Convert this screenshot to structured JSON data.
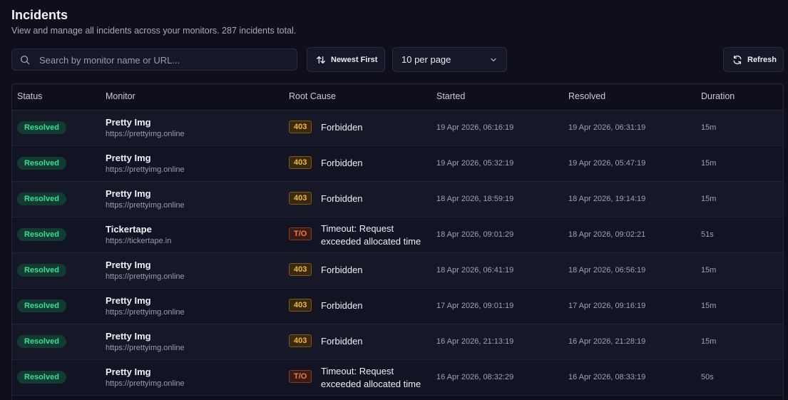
{
  "header": {
    "title": "Incidents",
    "subtitle": "View and manage all incidents across your monitors. 287 incidents total."
  },
  "toolbar": {
    "search_placeholder": "Search by monitor name or URL...",
    "sort_label": "Newest First",
    "per_page_value": "10 per page",
    "refresh_label": "Refresh"
  },
  "table": {
    "columns": [
      "Status",
      "Monitor",
      "Root Cause",
      "Started",
      "Resolved",
      "Duration"
    ],
    "rows": [
      {
        "status": "Resolved",
        "monitor": "Pretty Img",
        "url": "https://prettyimg.online",
        "code": "403",
        "cause": "Forbidden",
        "started": "19 Apr 2026, 06:16:19",
        "resolved": "19 Apr 2026, 06:31:19",
        "duration": "15m"
      },
      {
        "status": "Resolved",
        "monitor": "Pretty Img",
        "url": "https://prettyimg.online",
        "code": "403",
        "cause": "Forbidden",
        "started": "19 Apr 2026, 05:32:19",
        "resolved": "19 Apr 2026, 05:47:19",
        "duration": "15m"
      },
      {
        "status": "Resolved",
        "monitor": "Pretty Img",
        "url": "https://prettyimg.online",
        "code": "403",
        "cause": "Forbidden",
        "started": "18 Apr 2026, 18:59:19",
        "resolved": "18 Apr 2026, 19:14:19",
        "duration": "15m"
      },
      {
        "status": "Resolved",
        "monitor": "Tickertape",
        "url": "https://tickertape.in",
        "code": "T/O",
        "cause": "Timeout: Request exceeded allocated time",
        "started": "18 Apr 2026, 09:01:29",
        "resolved": "18 Apr 2026, 09:02:21",
        "duration": "51s"
      },
      {
        "status": "Resolved",
        "monitor": "Pretty Img",
        "url": "https://prettyimg.online",
        "code": "403",
        "cause": "Forbidden",
        "started": "18 Apr 2026, 06:41:19",
        "resolved": "18 Apr 2026, 06:56:19",
        "duration": "15m"
      },
      {
        "status": "Resolved",
        "monitor": "Pretty Img",
        "url": "https://prettyimg.online",
        "code": "403",
        "cause": "Forbidden",
        "started": "17 Apr 2026, 09:01:19",
        "resolved": "17 Apr 2026, 09:16:19",
        "duration": "15m"
      },
      {
        "status": "Resolved",
        "monitor": "Pretty Img",
        "url": "https://prettyimg.online",
        "code": "403",
        "cause": "Forbidden",
        "started": "16 Apr 2026, 21:13:19",
        "resolved": "16 Apr 2026, 21:28:19",
        "duration": "15m"
      },
      {
        "status": "Resolved",
        "monitor": "Pretty Img",
        "url": "https://prettyimg.online",
        "code": "T/O",
        "cause": "Timeout: Request exceeded allocated time",
        "started": "16 Apr 2026, 08:32:29",
        "resolved": "16 Apr 2026, 08:33:19",
        "duration": "50s"
      }
    ]
  },
  "colors": {
    "background": "#0f0f1c",
    "resolved_badge": "#3ddc97",
    "code_403": "#f5b63b",
    "code_timeout": "#f07a3e"
  },
  "icons": {
    "search": "search-icon",
    "sort": "sort-arrows-icon",
    "dropdown": "chevron-down-icon",
    "refresh": "refresh-icon"
  }
}
